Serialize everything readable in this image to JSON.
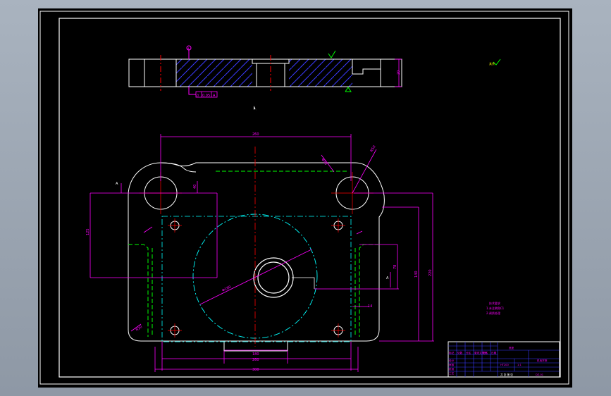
{
  "colors": {
    "background": "#000000",
    "outline": "#ffffff",
    "dimension": "#ff00ff",
    "centerline": "#ff0000",
    "hidden": "#00ff00",
    "hatch": "#3a3aff",
    "circle": "#00ffff",
    "yellow": "#ffff00"
  },
  "icons": {
    "cursor": "arrow-cursor-icon"
  },
  "annotations": {
    "surface_finish": "6.3",
    "datum": "A",
    "feature_control_a": "//",
    "feature_control_b": "0.05",
    "feature_control_c": "A",
    "section_mark": "A",
    "rough_mark": "其余",
    "leader_r": "R50",
    "leader_phi": "Φ50",
    "leader_r2": "R20"
  },
  "dimensions": {
    "top_width": "260",
    "bottom_1": "180",
    "bottom_2": "260",
    "bottom_3": "300",
    "left_height": "125",
    "right_height_1": "140",
    "right_height_2": "220",
    "right_small": "78",
    "offset_a": "14",
    "offset_b": "40",
    "side_height": "20",
    "phi_big": "Φ180"
  },
  "notes": {
    "title": "技术要求",
    "line1": "1.未注倒角C1",
    "line2": "2.调质处理"
  },
  "title_block": {
    "part_name": "底座",
    "material": "HT200",
    "scale": "1:1",
    "drawing_no": "DZ-01",
    "company": "机电学院",
    "row_labels": [
      "设计",
      "审核",
      "批准",
      "工艺"
    ],
    "headers": [
      "标记",
      "处数",
      "分区",
      "更改文件号",
      "签名",
      "日期"
    ],
    "footer": "共 张 第 张"
  }
}
